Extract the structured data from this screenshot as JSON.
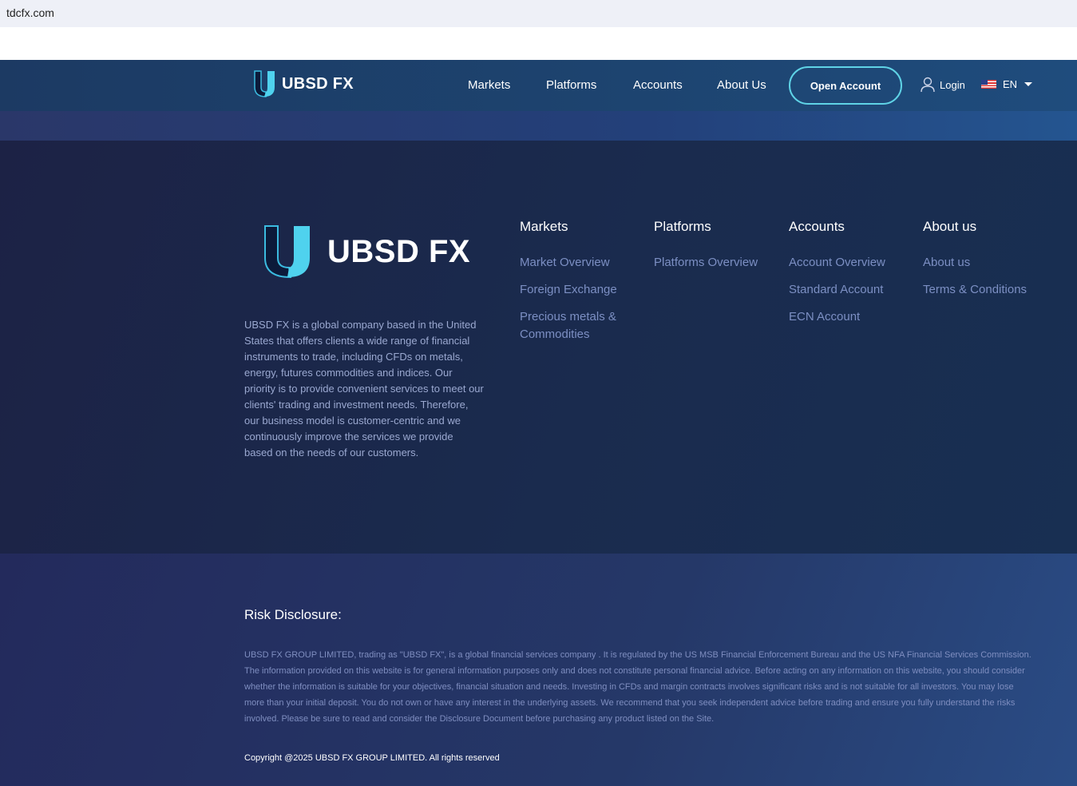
{
  "browser": {
    "url": "tdcfx.com"
  },
  "nav": {
    "brand": "UBSD FX",
    "items": [
      "Markets",
      "Platforms",
      "Accounts",
      "About Us"
    ],
    "open_account": "Open Account",
    "login": "Login",
    "language": "EN"
  },
  "footer": {
    "brand": "UBSD FX",
    "about": "UBSD FX is a global company based in the United States that offers clients a wide range of financial instruments to trade, including CFDs on metals, energy, futures commodities and indices. Our priority is to provide convenient services to meet our clients' trading and investment needs. Therefore, our business model is customer-centric and we continuously improve the services we provide based on the needs of our customers.",
    "columns": [
      {
        "title": "Markets",
        "links": [
          "Market Overview",
          "Foreign Exchange",
          "Precious metals & Commodities"
        ]
      },
      {
        "title": "Platforms",
        "links": [
          "Platforms Overview"
        ]
      },
      {
        "title": "Accounts",
        "links": [
          "Account Overview",
          "Standard Account",
          "ECN Account"
        ]
      },
      {
        "title": "About us",
        "links": [
          "About us",
          "Terms & Conditions"
        ]
      }
    ],
    "risk_title": "Risk Disclosure:",
    "risk_text": "UBSD FX GROUP LIMITED, trading as \"UBSD FX\", is a global financial services company . It is regulated by the US MSB Financial Enforcement Bureau and the US NFA Financial Services Commission. The information provided on this website is for general information purposes only and does not constitute personal financial advice. Before acting on any information on this website, you should consider whether the information is suitable for your objectives, financial situation and needs. Investing in CFDs and margin contracts involves significant risks and is not suitable for all investors. You may lose more than your initial deposit. You do not own or have any interest in the underlying assets. We recommend that you seek independent advice before trading and ensure you fully understand the risks involved. Please be sure to read and consider the Disclosure Document before purchasing any product listed on the Site.",
    "copyright": "Copyright @2025 UBSD FX GROUP LIMITED. All rights reserved"
  },
  "colors": {
    "accent": "#5fd3e6",
    "nav_bg": "#1d4470",
    "footer_bg": "#1a2b4e"
  },
  "icons": [
    "ubsd-logo-icon",
    "user-icon",
    "us-flag-icon",
    "caret-down-icon"
  ]
}
